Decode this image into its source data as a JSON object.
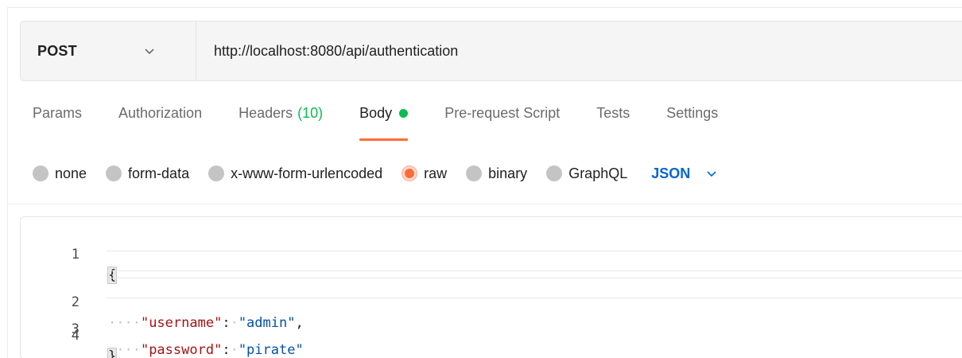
{
  "request": {
    "method": "POST",
    "url": "http://localhost:8080/api/authentication"
  },
  "tabs": [
    {
      "label": "Params"
    },
    {
      "label": "Authorization"
    },
    {
      "label": "Headers",
      "count": "(10)"
    },
    {
      "label": "Body",
      "active": true
    },
    {
      "label": "Pre-request Script"
    },
    {
      "label": "Tests"
    },
    {
      "label": "Settings"
    }
  ],
  "body_types": [
    {
      "label": "none"
    },
    {
      "label": "form-data"
    },
    {
      "label": "x-www-form-urlencoded"
    },
    {
      "label": "raw",
      "selected": true
    },
    {
      "label": "binary"
    },
    {
      "label": "GraphQL"
    }
  ],
  "raw_language": "JSON",
  "editor": {
    "line_numbers": [
      "1",
      "2",
      "3",
      "4"
    ],
    "open_brace": "{",
    "close_brace": "}",
    "indent": "····",
    "field1_key": "\"username\"",
    "field1_value": "\"admin\"",
    "field2_key": "\"password\"",
    "field2_value": "\"pirate\""
  },
  "colors": {
    "accent_orange": "#ff6c37",
    "active_green": "#0cbb52",
    "link_blue": "#0265d2",
    "json_key": "#a31515",
    "json_string": "#0451a5"
  },
  "icons": {
    "method_dropdown": "chevron-down-icon",
    "language_dropdown": "chevron-down-icon"
  }
}
